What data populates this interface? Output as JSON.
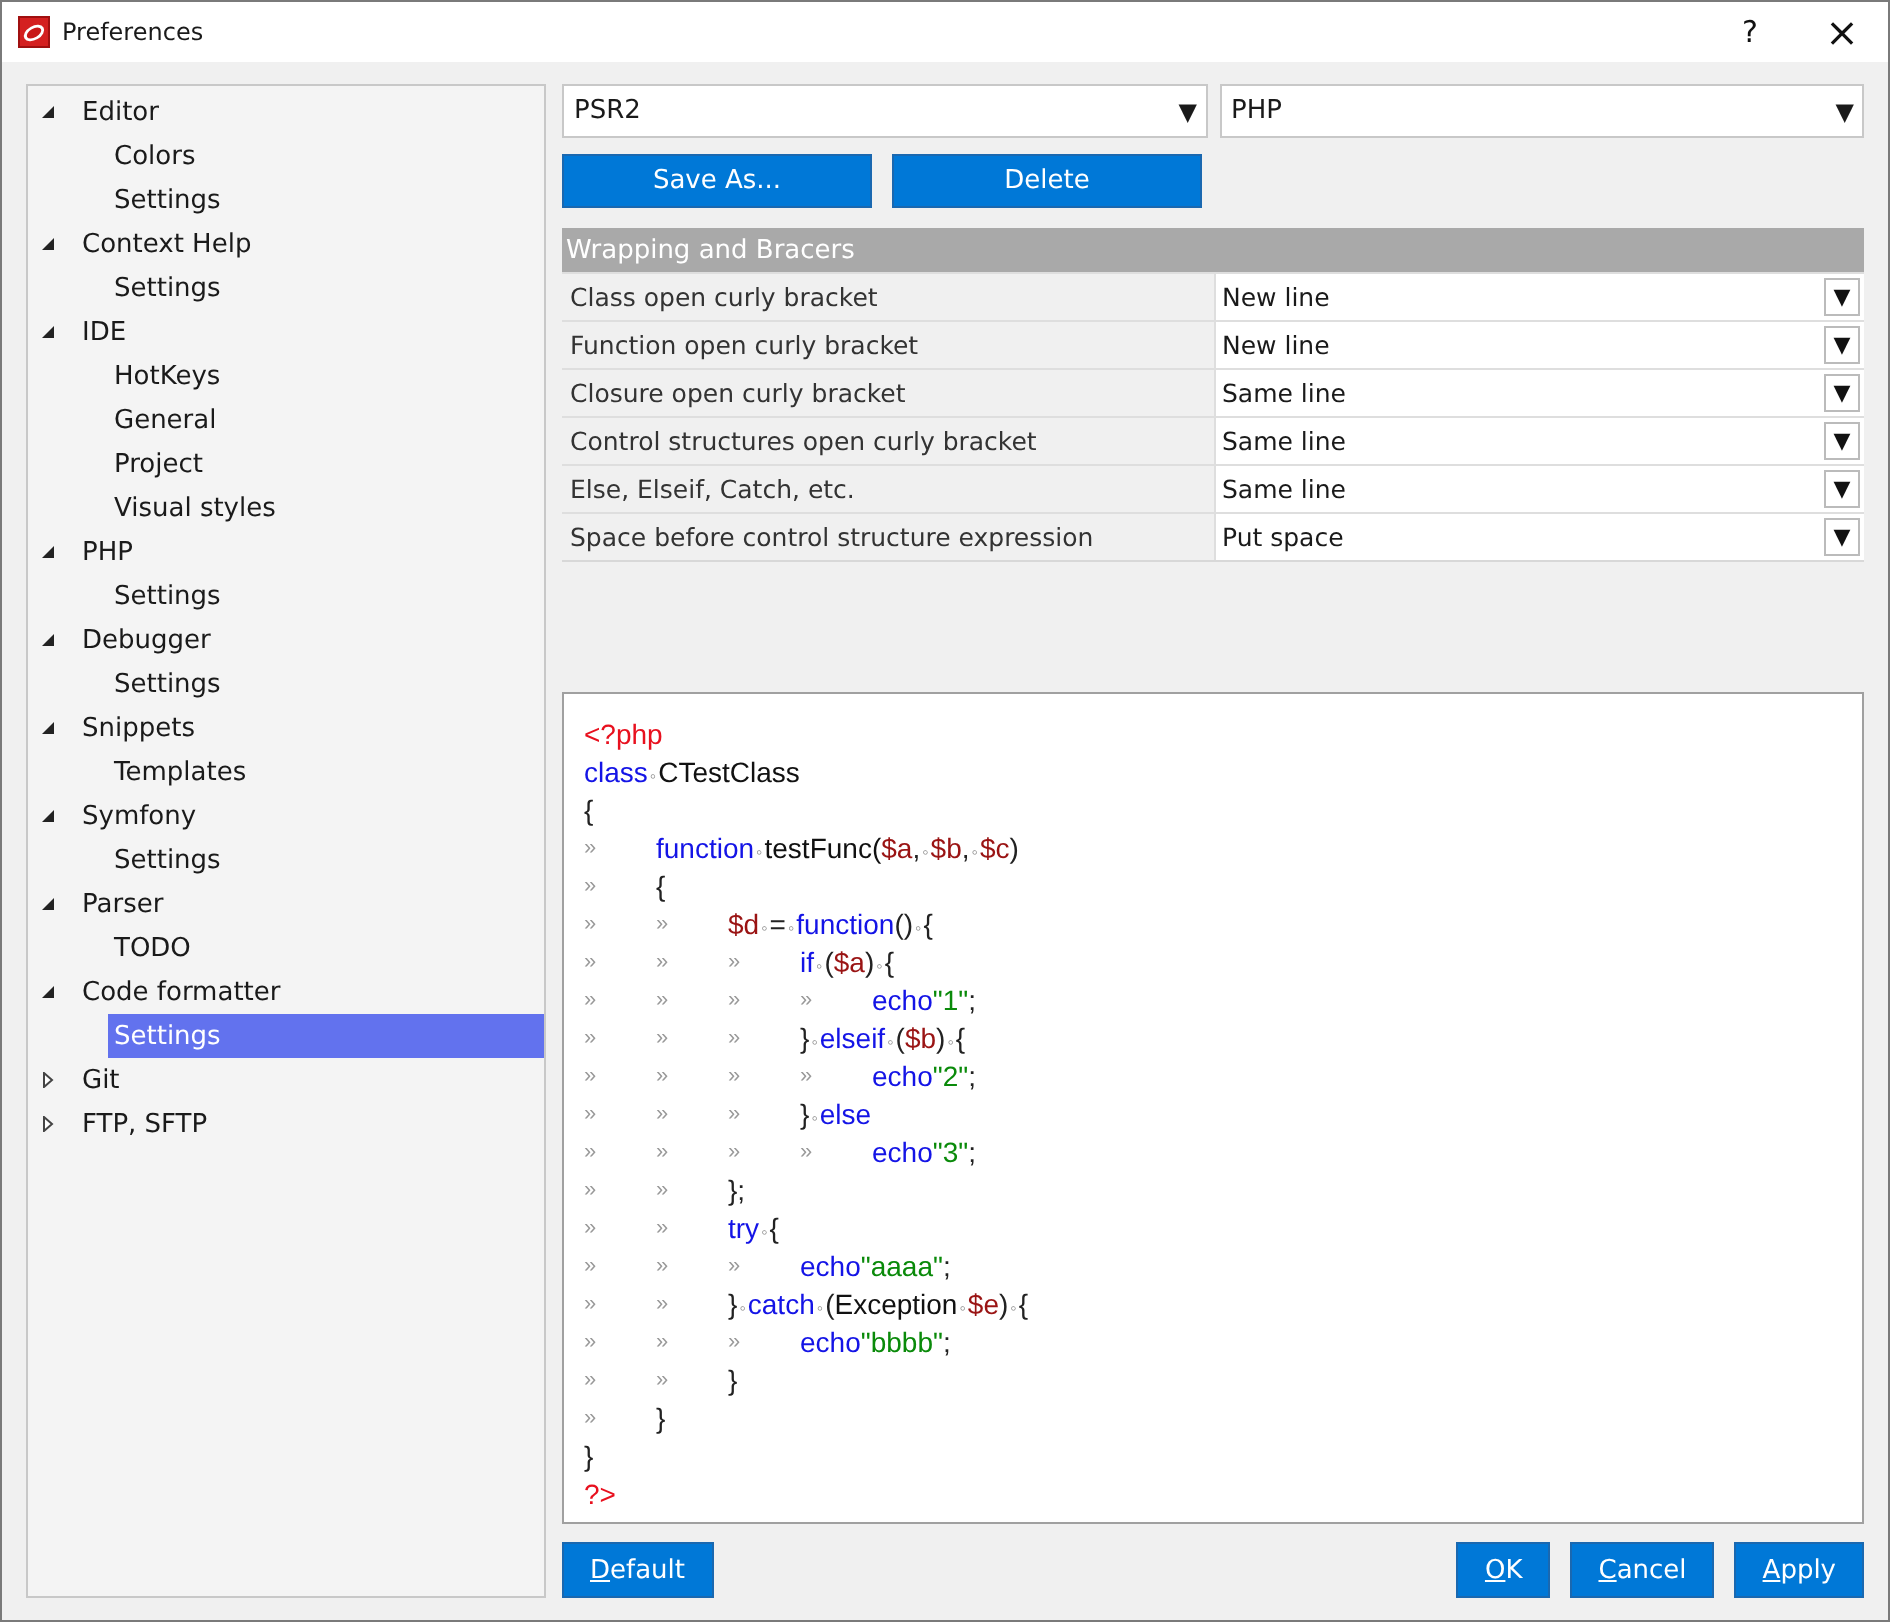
{
  "window": {
    "title": "Preferences",
    "help": "?",
    "close": "×"
  },
  "tree": [
    {
      "label": "Editor",
      "expanded": true,
      "selected": false,
      "children": [
        {
          "label": "Colors",
          "selected": false
        },
        {
          "label": "Settings",
          "selected": false
        }
      ]
    },
    {
      "label": "Context Help",
      "expanded": true,
      "selected": false,
      "children": [
        {
          "label": "Settings",
          "selected": false
        }
      ]
    },
    {
      "label": "IDE",
      "expanded": true,
      "selected": false,
      "children": [
        {
          "label": "HotKeys",
          "selected": false
        },
        {
          "label": "General",
          "selected": false
        },
        {
          "label": "Project",
          "selected": false
        },
        {
          "label": "Visual styles",
          "selected": false
        }
      ]
    },
    {
      "label": "PHP",
      "expanded": true,
      "selected": false,
      "children": [
        {
          "label": "Settings",
          "selected": false
        }
      ]
    },
    {
      "label": "Debugger",
      "expanded": true,
      "selected": false,
      "children": [
        {
          "label": "Settings",
          "selected": false
        }
      ]
    },
    {
      "label": "Snippets",
      "expanded": true,
      "selected": false,
      "children": [
        {
          "label": "Templates",
          "selected": false
        }
      ]
    },
    {
      "label": "Symfony",
      "expanded": true,
      "selected": false,
      "children": [
        {
          "label": "Settings",
          "selected": false
        }
      ]
    },
    {
      "label": "Parser",
      "expanded": true,
      "selected": false,
      "children": [
        {
          "label": "TODO",
          "selected": false
        }
      ]
    },
    {
      "label": "Code formatter",
      "expanded": true,
      "selected": false,
      "children": [
        {
          "label": "Settings",
          "selected": true
        }
      ]
    },
    {
      "label": "Git",
      "expanded": false,
      "selected": false
    },
    {
      "label": "FTP, SFTP",
      "expanded": false,
      "selected": false
    }
  ],
  "profile": {
    "value": "PSR2",
    "arrow": "▼"
  },
  "language": {
    "value": "PHP",
    "arrow": "▼"
  },
  "actions": [
    "Save As...",
    "Delete"
  ],
  "section": {
    "title": "Wrapping and Bracers",
    "rows": [
      {
        "label": "Class open curly bracket",
        "value": "New line",
        "arrow": "▼"
      },
      {
        "label": "Function open curly bracket",
        "value": "New line",
        "arrow": "▼"
      },
      {
        "label": "Closure open curly bracket",
        "value": "Same line",
        "arrow": "▼"
      },
      {
        "label": "Control structures open curly bracket",
        "value": "Same line",
        "arrow": "▼"
      },
      {
        "label": "Else, Elseif, Catch, etc.",
        "value": "Same line",
        "arrow": "▼"
      },
      {
        "label": "Space before control structure expression",
        "value": "Put space",
        "arrow": "▼"
      }
    ]
  },
  "preview": [
    [
      {
        "kind": "tag",
        "text": "<?php"
      }
    ],
    [
      {
        "kind": "kw",
        "text": "class"
      },
      {
        "kind": "sp",
        "text": "◦"
      },
      {
        "kind": "id",
        "text": "CTestClass"
      }
    ],
    [
      {
        "kind": "p",
        "text": "{"
      }
    ],
    [
      {
        "kind": "tab",
        "text": "»"
      },
      {
        "kind": "kw",
        "text": "function"
      },
      {
        "kind": "sp",
        "text": "◦"
      },
      {
        "kind": "id",
        "text": "testFunc("
      },
      {
        "kind": "var",
        "text": "$a"
      },
      {
        "kind": "p",
        "text": ","
      },
      {
        "kind": "sp",
        "text": "◦"
      },
      {
        "kind": "var",
        "text": "$b"
      },
      {
        "kind": "p",
        "text": ","
      },
      {
        "kind": "sp",
        "text": "◦"
      },
      {
        "kind": "var",
        "text": "$c"
      },
      {
        "kind": "p",
        "text": ")"
      }
    ],
    [
      {
        "kind": "tab",
        "text": "»"
      },
      {
        "kind": "p",
        "text": "{"
      }
    ],
    [
      {
        "kind": "tab",
        "text": "»"
      },
      {
        "kind": "tab",
        "text": "»"
      },
      {
        "kind": "var",
        "text": "$d"
      },
      {
        "kind": "sp",
        "text": "◦"
      },
      {
        "kind": "p",
        "text": "="
      },
      {
        "kind": "sp",
        "text": "◦"
      },
      {
        "kind": "kw",
        "text": "function"
      },
      {
        "kind": "p",
        "text": "()"
      },
      {
        "kind": "sp",
        "text": "◦"
      },
      {
        "kind": "p",
        "text": "{"
      }
    ],
    [
      {
        "kind": "tab",
        "text": "»"
      },
      {
        "kind": "tab",
        "text": "»"
      },
      {
        "kind": "tab",
        "text": "»"
      },
      {
        "kind": "kw",
        "text": "if"
      },
      {
        "kind": "sp",
        "text": "◦"
      },
      {
        "kind": "p",
        "text": "("
      },
      {
        "kind": "var",
        "text": "$a"
      },
      {
        "kind": "p",
        "text": ")"
      },
      {
        "kind": "sp",
        "text": "◦"
      },
      {
        "kind": "p",
        "text": "{"
      }
    ],
    [
      {
        "kind": "tab",
        "text": "»"
      },
      {
        "kind": "tab",
        "text": "»"
      },
      {
        "kind": "tab",
        "text": "»"
      },
      {
        "kind": "tab",
        "text": "»"
      },
      {
        "kind": "kw",
        "text": "echo"
      },
      {
        "kind": "str",
        "text": "\"1\""
      },
      {
        "kind": "p",
        "text": ";"
      }
    ],
    [
      {
        "kind": "tab",
        "text": "»"
      },
      {
        "kind": "tab",
        "text": "»"
      },
      {
        "kind": "tab",
        "text": "»"
      },
      {
        "kind": "p",
        "text": "}"
      },
      {
        "kind": "sp",
        "text": "◦"
      },
      {
        "kind": "kw",
        "text": "elseif"
      },
      {
        "kind": "sp",
        "text": "◦"
      },
      {
        "kind": "p",
        "text": "("
      },
      {
        "kind": "var",
        "text": "$b"
      },
      {
        "kind": "p",
        "text": ")"
      },
      {
        "kind": "sp",
        "text": "◦"
      },
      {
        "kind": "p",
        "text": "{"
      }
    ],
    [
      {
        "kind": "tab",
        "text": "»"
      },
      {
        "kind": "tab",
        "text": "»"
      },
      {
        "kind": "tab",
        "text": "»"
      },
      {
        "kind": "tab",
        "text": "»"
      },
      {
        "kind": "kw",
        "text": "echo"
      },
      {
        "kind": "str",
        "text": "\"2\""
      },
      {
        "kind": "p",
        "text": ";"
      }
    ],
    [
      {
        "kind": "tab",
        "text": "»"
      },
      {
        "kind": "tab",
        "text": "»"
      },
      {
        "kind": "tab",
        "text": "»"
      },
      {
        "kind": "p",
        "text": "}"
      },
      {
        "kind": "sp",
        "text": "◦"
      },
      {
        "kind": "kw",
        "text": "else"
      }
    ],
    [
      {
        "kind": "tab",
        "text": "»"
      },
      {
        "kind": "tab",
        "text": "»"
      },
      {
        "kind": "tab",
        "text": "»"
      },
      {
        "kind": "tab",
        "text": "»"
      },
      {
        "kind": "kw",
        "text": "echo"
      },
      {
        "kind": "str",
        "text": "\"3\""
      },
      {
        "kind": "p",
        "text": ";"
      }
    ],
    [
      {
        "kind": "tab",
        "text": "»"
      },
      {
        "kind": "tab",
        "text": "»"
      },
      {
        "kind": "p",
        "text": "};"
      }
    ],
    [
      {
        "kind": "tab",
        "text": "»"
      },
      {
        "kind": "tab",
        "text": "»"
      },
      {
        "kind": "kw",
        "text": "try"
      },
      {
        "kind": "sp",
        "text": "◦"
      },
      {
        "kind": "p",
        "text": "{"
      }
    ],
    [
      {
        "kind": "tab",
        "text": "»"
      },
      {
        "kind": "tab",
        "text": "»"
      },
      {
        "kind": "tab",
        "text": "»"
      },
      {
        "kind": "kw",
        "text": "echo"
      },
      {
        "kind": "str",
        "text": "\"aaaa\""
      },
      {
        "kind": "p",
        "text": ";"
      }
    ],
    [
      {
        "kind": "tab",
        "text": "»"
      },
      {
        "kind": "tab",
        "text": "»"
      },
      {
        "kind": "p",
        "text": "}"
      },
      {
        "kind": "sp",
        "text": "◦"
      },
      {
        "kind": "kw",
        "text": "catch"
      },
      {
        "kind": "sp",
        "text": "◦"
      },
      {
        "kind": "p",
        "text": "("
      },
      {
        "kind": "id",
        "text": "Exception"
      },
      {
        "kind": "sp",
        "text": "◦"
      },
      {
        "kind": "var",
        "text": "$e"
      },
      {
        "kind": "p",
        "text": ")"
      },
      {
        "kind": "sp",
        "text": "◦"
      },
      {
        "kind": "p",
        "text": "{"
      }
    ],
    [
      {
        "kind": "tab",
        "text": "»"
      },
      {
        "kind": "tab",
        "text": "»"
      },
      {
        "kind": "tab",
        "text": "»"
      },
      {
        "kind": "kw",
        "text": "echo"
      },
      {
        "kind": "str",
        "text": "\"bbbb\""
      },
      {
        "kind": "p",
        "text": ";"
      }
    ],
    [
      {
        "kind": "tab",
        "text": "»"
      },
      {
        "kind": "tab",
        "text": "»"
      },
      {
        "kind": "p",
        "text": "}"
      }
    ],
    [
      {
        "kind": "tab",
        "text": "»"
      },
      {
        "kind": "p",
        "text": "}"
      }
    ],
    [
      {
        "kind": "p",
        "text": "}"
      }
    ],
    [
      {
        "kind": "tag",
        "text": "?>"
      }
    ]
  ],
  "footer": {
    "left": [
      {
        "key": "D",
        "rest": "efault"
      }
    ],
    "right": [
      {
        "key": "O",
        "rest": "K"
      },
      {
        "key": "C",
        "rest": "ancel"
      },
      {
        "key": "A",
        "rest": "pply"
      }
    ]
  }
}
